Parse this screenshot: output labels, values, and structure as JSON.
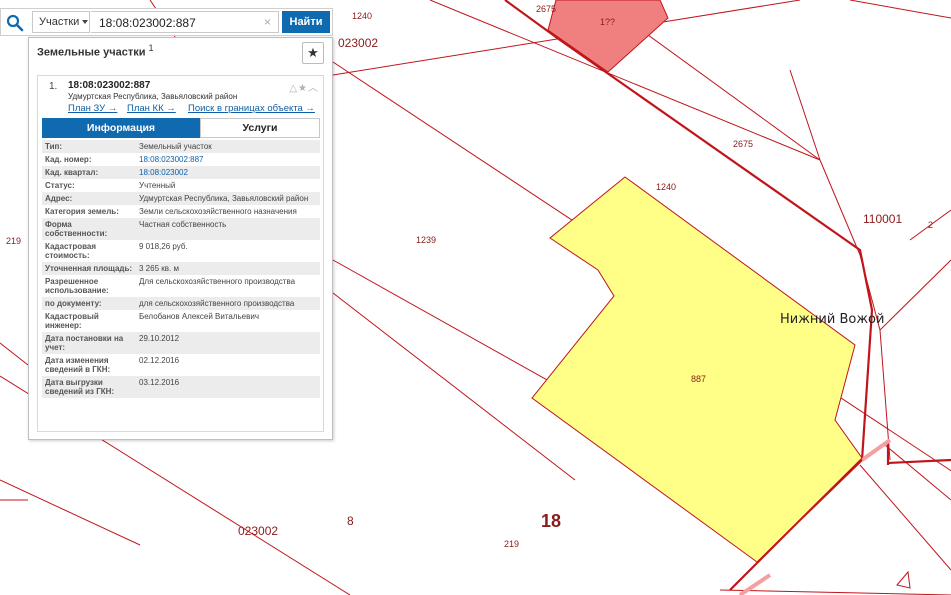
{
  "search": {
    "type_label": "Участки",
    "query": "18:08:023002:887",
    "clear_symbol": "×",
    "button_label": "Найти"
  },
  "panel": {
    "title": "Земельные участки",
    "title_count": "1",
    "card": {
      "index": "1.",
      "cad_number": "18:08:023002:887",
      "address": "Удмуртская Республика, Завьяловский район",
      "links": [
        "План ЗУ →",
        "План КК →",
        "Поиск в границах объекта →"
      ],
      "tabs": [
        "Информация",
        "Услуги"
      ],
      "attributes": [
        {
          "key": "Тип:",
          "value": "Земельный участок"
        },
        {
          "key": "Кад. номер:",
          "value": "18:08:023002:887"
        },
        {
          "key": "Кад. квартал:",
          "value": "18:08:023002"
        },
        {
          "key": "Статус:",
          "value": "Учтенный"
        },
        {
          "key": "Адрес:",
          "value": "Удмуртская Республика, Завьяловский район"
        },
        {
          "key": "Категория земель:",
          "value": "Земли сельскохозяйственного назначения"
        },
        {
          "key": "Форма собственности:",
          "value": "Частная собственность"
        },
        {
          "key": "Кадастровая стоимость:",
          "value": "9 018,26 руб."
        },
        {
          "key": "Уточненная площадь:",
          "value": "3 265 кв. м"
        },
        {
          "key": "Разрешенное использование:",
          "value": "Для сельскохозяйственного производства"
        },
        {
          "key": "по документу:",
          "value": "для сельскохозяйственного производства"
        },
        {
          "key": "Кадастровый инженер:",
          "value": "Белобанов Алексей Витальевич"
        },
        {
          "key": "Дата постановки на учет:",
          "value": "29.10.2012"
        },
        {
          "key": "Дата изменения сведений в ГКН:",
          "value": "02.12.2016"
        },
        {
          "key": "Дата выгрузки сведений из ГКН:",
          "value": "03.12.2016"
        }
      ]
    }
  },
  "map": {
    "labels": [
      "1240",
      "2675",
      "1239",
      "023002",
      "2675",
      "1240",
      "110001",
      "219",
      "1239",
      "887",
      "023002",
      "8",
      "18",
      "219",
      "2",
      "Нижний Вожой"
    ],
    "red_parcel_label": "1??",
    "colors": {
      "boundary": "#c0151b",
      "selected_fill": "#ffff88",
      "red_parcel_fill": "#f08080",
      "label": "#8b1a1a"
    }
  }
}
